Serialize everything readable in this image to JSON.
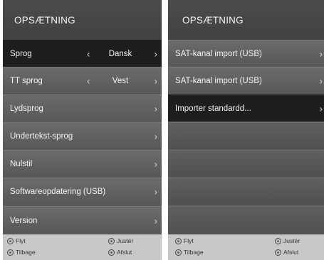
{
  "left": {
    "title": "OPSÆTNING",
    "items": [
      {
        "label": "Sprog",
        "value": "Dansk",
        "selected": true
      },
      {
        "label": "TT sprog",
        "value": "Vest"
      },
      {
        "label": "Lydsprog"
      },
      {
        "label": "Undertekst-sprog"
      },
      {
        "label": "Nulstil"
      },
      {
        "label": "Softwareopdatering (USB)"
      },
      {
        "label": "Version"
      }
    ],
    "footer": {
      "move": "Flyt",
      "back": "Tilbage",
      "adjust": "Justér",
      "exit": "Afslut"
    }
  },
  "right": {
    "title": "OPSÆTNING",
    "items": [
      {
        "label": "SAT-kanal import (USB)"
      },
      {
        "label": "SAT-kanal import (USB)"
      },
      {
        "label": "Importer standardd..."
      }
    ],
    "footer": {
      "move": "Flyt",
      "back": "Tilbage",
      "adjust": "Justér",
      "exit": "Afslut"
    }
  },
  "icons": {
    "arrow_left": "‹",
    "arrow_right": "›"
  }
}
